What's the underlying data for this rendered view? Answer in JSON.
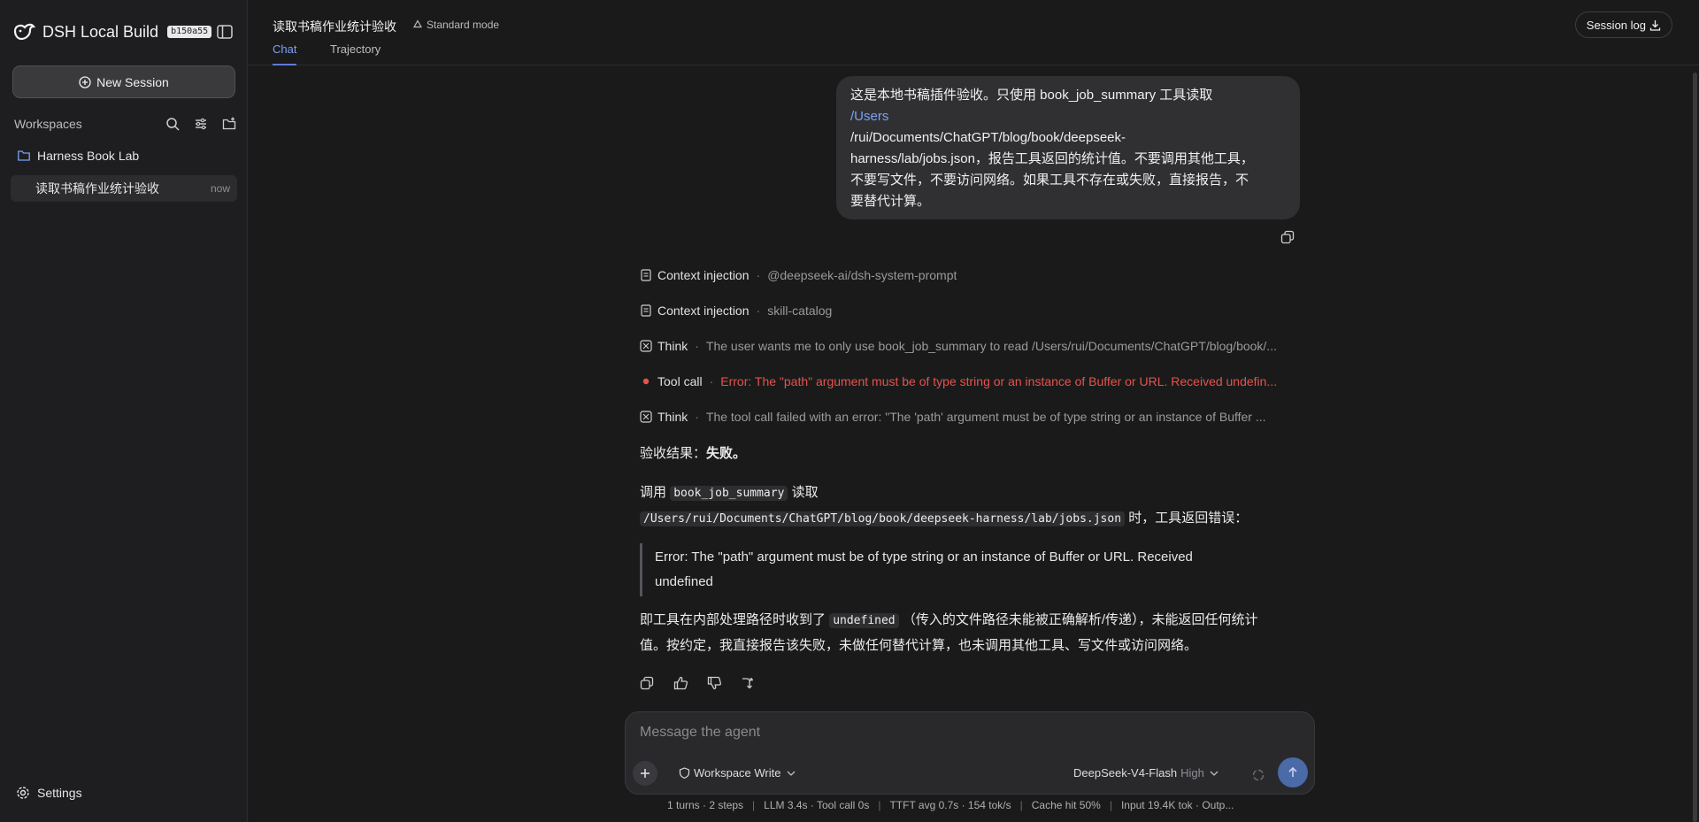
{
  "sidebar": {
    "brand_title": "DSH Local Build",
    "build_badge": "b150a55",
    "new_session_label": "New Session",
    "workspaces_label": "Workspaces",
    "project_name": "Harness Book Lab",
    "session": {
      "label": "读取书稿作业统计验收",
      "time": "now"
    },
    "settings_label": "Settings"
  },
  "header": {
    "title": "读取书稿作业统计验收",
    "mode": "Standard mode",
    "tabs": [
      {
        "label": "Chat",
        "active": true
      },
      {
        "label": "Trajectory",
        "active": false
      }
    ],
    "session_log_label": "Session log"
  },
  "chat": {
    "user_message": {
      "line1": "这是本地书稿插件验收。只使用 book_job_summary 工具读取",
      "link": "/Users",
      "line2": "/rui/Documents/ChatGPT/blog/book/deepseek-",
      "line3": "harness/lab/jobs.json，报告工具返回的统计值。不要调用其他工具，",
      "line4": "不要写文件，不要访问网络。如果工具不存在或失败，直接报告，不",
      "line5": "要替代计算。"
    },
    "steps": [
      {
        "name": "Context injection",
        "sep": "·",
        "detail": "@deepseek-ai/dsh-system-prompt",
        "icon": "doc-icon"
      },
      {
        "name": "Context injection",
        "sep": "·",
        "detail": "skill-catalog",
        "icon": "doc-icon"
      },
      {
        "name": "Think",
        "sep": "·",
        "detail": "The user wants me to only use book_job_summary to read /Users/rui/Documents/ChatGPT/blog/book/...",
        "icon": "think-icon"
      },
      {
        "name": "Tool call",
        "sep": "·",
        "detail": "Error: The \"path\" argument must be of type string or an instance of Buffer or URL. Received undefin...",
        "icon": "error-dot-icon"
      },
      {
        "name": "Think",
        "sep": "·",
        "detail": "The tool call failed with an error: \"The 'path' argument must be of type string or an instance of Buffer ...",
        "icon": "think-icon"
      }
    ],
    "assistant": {
      "result_prefix": "验收结果：",
      "result_value": "失败。",
      "call_prefix": "调用",
      "call_tool": "book_job_summary",
      "call_mid": "读取",
      "call_path": "/Users/rui/Documents/ChatGPT/blog/book/deepseek-harness/lab/jobs.json",
      "call_suffix": "时，工具返回错误：",
      "quote_line1": "Error: The \"path\" argument must be of type string or an instance of Buffer or URL. Received",
      "quote_line2": "undefined",
      "explain_prefix": "即工具在内部处理路径时收到了",
      "explain_code": "undefined",
      "explain_suffix": "（传入的文件路径未能被正确解析/传递），未能返回任何统计",
      "explain_line2": "值。按约定，我直接报告该失败，未做任何替代计算，也未调用其他工具、写文件或访问网络。"
    }
  },
  "composer": {
    "placeholder": "Message the agent",
    "permission": "Workspace Write",
    "model": "DeepSeek-V4-Flash",
    "effort": "High"
  },
  "stats": {
    "turns": "1 turns · 2 steps",
    "llm": "LLM 3.4s · Tool call 0s",
    "ttft": "TTFT avg 0.7s · 154 tok/s",
    "cache": "Cache hit 50%",
    "input": "Input 19.4K tok · Outp..."
  },
  "colors": {
    "accent": "#7aa2f7",
    "error": "#e5534b",
    "background": "#1a1a1b",
    "sidebar": "#1e1e20"
  }
}
